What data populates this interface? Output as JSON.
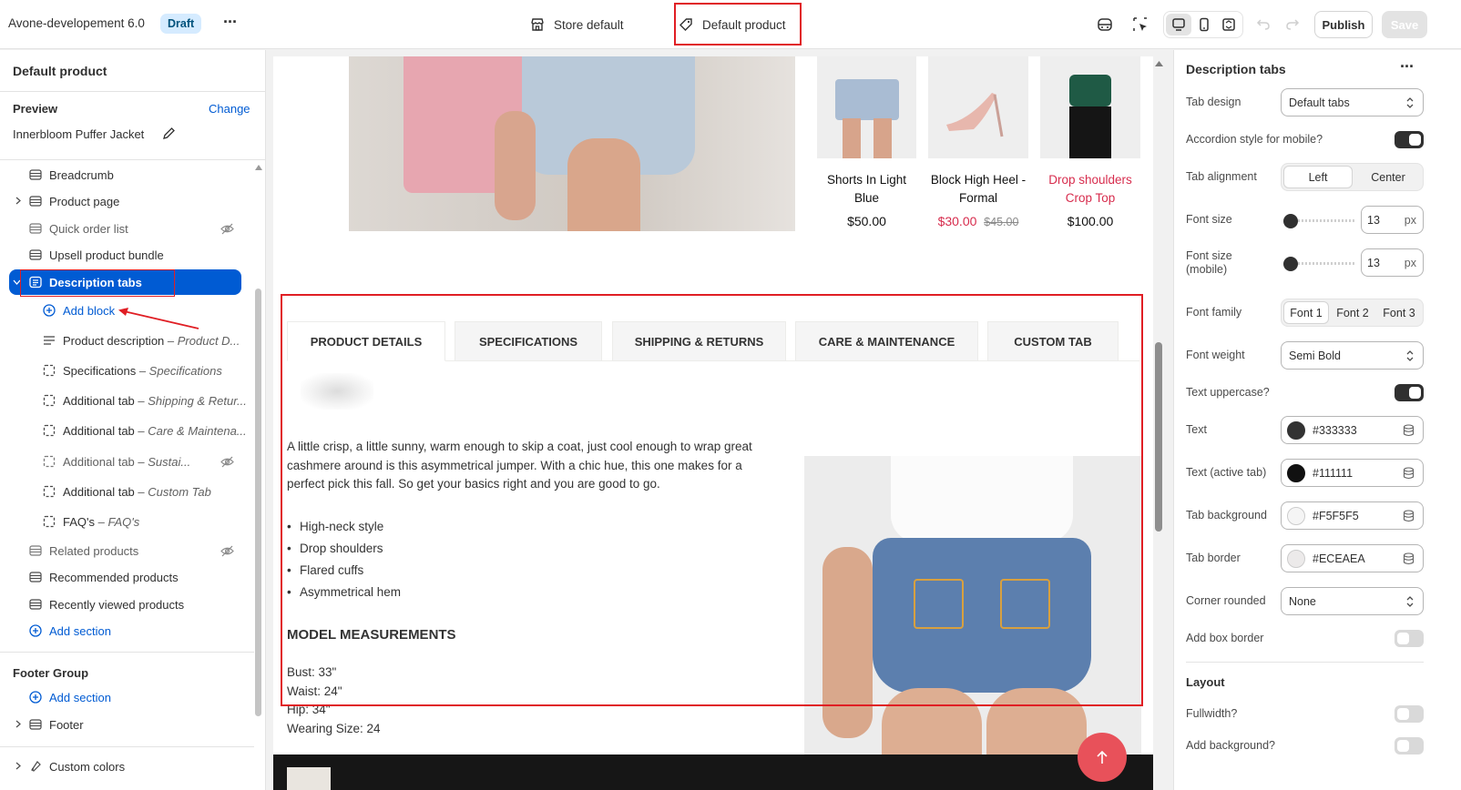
{
  "topbar": {
    "app_title": "Avone-developement 6.0",
    "status_badge": "Draft",
    "more_label": "···",
    "center_tab_store": "Store default",
    "center_tab_product": "Default product",
    "publish_label": "Publish",
    "save_label": "Save"
  },
  "left_panel": {
    "title": "Default product",
    "preview_label": "Preview",
    "change_label": "Change",
    "preview_product": "Innerbloom Puffer Jacket",
    "sections": [
      {
        "label": "Breadcrumb",
        "icon": "section-icon"
      },
      {
        "label": "Product page",
        "icon": "section-icon"
      },
      {
        "label": "Quick order list",
        "icon": "section-icon",
        "hidden": true
      },
      {
        "label": "Upsell product bundle",
        "icon": "section-icon"
      },
      {
        "label": "Description tabs",
        "icon": "section-icon",
        "selected": true
      }
    ],
    "add_block_label": "Add block",
    "blocks": [
      {
        "name": "Product description",
        "sub": "– Product D..."
      },
      {
        "name": "Specifications",
        "sub": "– Specifications"
      },
      {
        "name": "Additional tab",
        "sub": "– Shipping & Retur..."
      },
      {
        "name": "Additional tab",
        "sub": "– Care & Maintena..."
      },
      {
        "name": "Additional tab",
        "sub": "– Sustai..."
      },
      {
        "name": "Additional tab",
        "sub": "– Custom Tab"
      },
      {
        "name": "FAQ's",
        "sub": "– FAQ's"
      }
    ],
    "more_sections": [
      "Related products",
      "Recommended products",
      "Recently viewed products"
    ],
    "add_section_label": "Add section",
    "footer_group_label": "Footer Group",
    "footer_add_section": "Add section",
    "footer_label": "Footer",
    "custom_colors_label": "Custom colors"
  },
  "canvas": {
    "products": [
      {
        "name_line1": "Shorts In Light",
        "name_line2": "Blue",
        "price": "$50.00"
      },
      {
        "name_line1": "Block High Heel -",
        "name_line2": "Formal",
        "sale_price": "$30.00",
        "compare_price": "$45.00"
      },
      {
        "name_line1": "Drop shoulders",
        "name_line2": "Crop Top",
        "price": "$100.00"
      }
    ],
    "tabs": [
      "PRODUCT DETAILS",
      "SPECIFICATIONS",
      "SHIPPING & RETURNS",
      "CARE & MAINTENANCE",
      "CUSTOM TAB"
    ],
    "description_line1": "A little crisp, a little sunny, warm enough to skip a coat, just cool enough to wrap great",
    "description_line2": "cashmere around is this asymmetrical jumper. With a chic hue, this one makes for a",
    "description_line3": "perfect pick this fall. So get your basics right and you are good to go.",
    "bullets": [
      "High-neck style",
      "Drop shoulders",
      "Flared cuffs",
      "Asymmetrical hem"
    ],
    "measurements_title": "MODEL MEASUREMENTS",
    "measurements": [
      "Bust: 33\"",
      "Waist: 24\"",
      "Hip: 34\"",
      "Wearing Size: 24"
    ]
  },
  "right_panel": {
    "title": "Description tabs",
    "tab_design_label": "Tab design",
    "tab_design_value": "Default tabs",
    "accordion_label": "Accordion style for mobile?",
    "tab_alignment_label": "Tab alignment",
    "align_left": "Left",
    "align_center": "Center",
    "font_size_label": "Font size",
    "font_size_value": "13",
    "font_size_mobile_label_1": "Font size",
    "font_size_mobile_label_2": "(mobile)",
    "font_size_mobile_value": "13",
    "px_unit": "px",
    "font_family_label": "Font family",
    "font_options": [
      "Font 1",
      "Font 2",
      "Font 3"
    ],
    "font_weight_label": "Font weight",
    "font_weight_value": "Semi Bold",
    "uppercase_label": "Text uppercase?",
    "text_label": "Text",
    "text_color": "#333333",
    "text_active_label": "Text (active tab)",
    "text_active_color": "#111111",
    "tab_bg_label": "Tab background",
    "tab_bg_color": "#F5F5F5",
    "tab_border_label": "Tab border",
    "tab_border_color": "#ECEAEA",
    "corner_label": "Corner rounded",
    "corner_value": "None",
    "box_border_label": "Add box border",
    "layout_label": "Layout",
    "fullwidth_label": "Fullwidth?",
    "add_bg_label": "Add background?"
  },
  "colors": {
    "accent_blue": "#005bd3",
    "annotation_red": "#e01e24",
    "sale_red": "#d72c4d"
  }
}
